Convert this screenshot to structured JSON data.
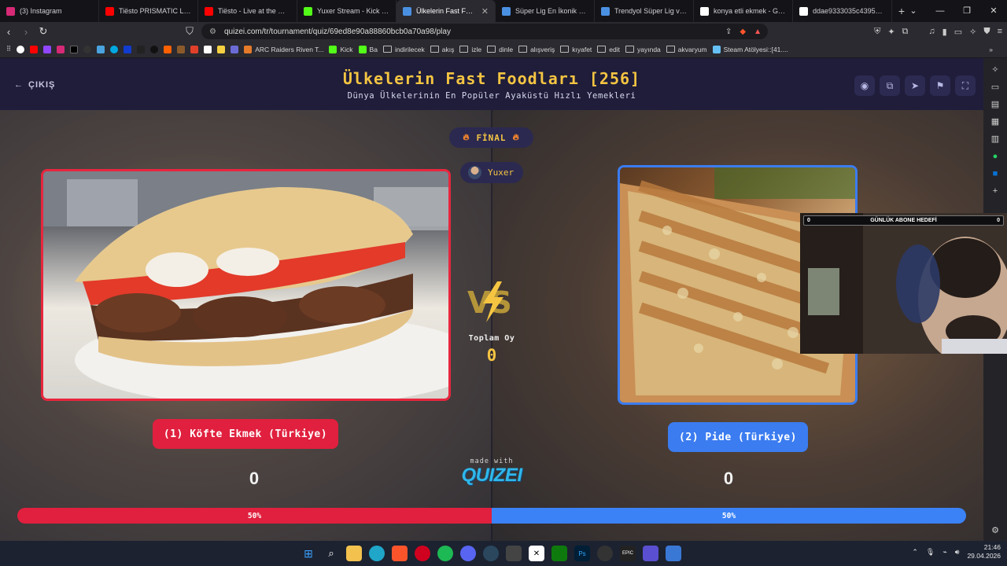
{
  "browser": {
    "tabs": [
      {
        "title": "(3) Instagram",
        "color": "#d62976"
      },
      {
        "title": "Tiësto PRISMATIC Live Me",
        "color": "#ff0000"
      },
      {
        "title": "Tiësto - Live at the Great P",
        "color": "#ff0000"
      },
      {
        "title": "Yuxer Stream - Kick Da",
        "color": "#53fc18"
      },
      {
        "title": "Ülkelerin Fast Foodlar",
        "color": "#4a90e2",
        "active": true
      },
      {
        "title": "Süper Lig En İkonik Gol Se",
        "color": "#4a90e2"
      },
      {
        "title": "Trendyol Süper Lig ve 1.Lig",
        "color": "#4a90e2"
      },
      {
        "title": "konya etli ekmek - Google",
        "color": "#ffffff"
      },
      {
        "title": "ddae9333035c43958dcdd",
        "color": "#ffffff"
      }
    ],
    "url": "quizei.com/tr/tournament/quiz/69ed8e90a88860bcb0a70a98/play",
    "bookmarks": [
      {
        "label": "ARC Raiders Riven T...",
        "type": "site",
        "color": "#e57a2a"
      },
      {
        "label": "Kick",
        "type": "site",
        "color": "#53fc18"
      },
      {
        "label": "Ba",
        "type": "site",
        "color": "#53fc18"
      },
      {
        "label": "indirilecek",
        "type": "folder"
      },
      {
        "label": "akış",
        "type": "folder"
      },
      {
        "label": "izle",
        "type": "folder"
      },
      {
        "label": "dinle",
        "type": "folder"
      },
      {
        "label": "alışveriş",
        "type": "folder"
      },
      {
        "label": "kıyafet",
        "type": "folder"
      },
      {
        "label": "edit",
        "type": "folder"
      },
      {
        "label": "yayında",
        "type": "folder"
      },
      {
        "label": "akvaryum",
        "type": "folder"
      },
      {
        "label": "Steam Atölyesi::[41....",
        "type": "site",
        "color": "#66c0f4"
      }
    ]
  },
  "page": {
    "exit_label": "ÇIKIŞ",
    "title": "Ülkelerin Fast Foodları [256]",
    "subtitle": "Dünya Ülkelerinin En Popüler Ayaküstü Hızlı Yemekleri",
    "round_label": "FİNAL",
    "username": "Yuxer",
    "total_label": "Toplam Oy",
    "total_value": "0",
    "made_with": "made with",
    "brand": "QUIZEI",
    "left": {
      "name": "(1) Köfte Ekmek (Türkiye)",
      "votes": "0",
      "percent_label": "50%",
      "percent": 50,
      "color": "#e0203e"
    },
    "right": {
      "name": "(2) Pide (Türkiye)",
      "votes": "0",
      "percent_label": "50%",
      "percent": 50,
      "color": "#3b82f6"
    }
  },
  "overlay": {
    "goal_title": "GÜNLÜK ABONE HEDEFİ",
    "goal_current": "0",
    "goal_target": "0"
  },
  "taskbar": {
    "time": "21:46",
    "date": "29.04.2026"
  }
}
